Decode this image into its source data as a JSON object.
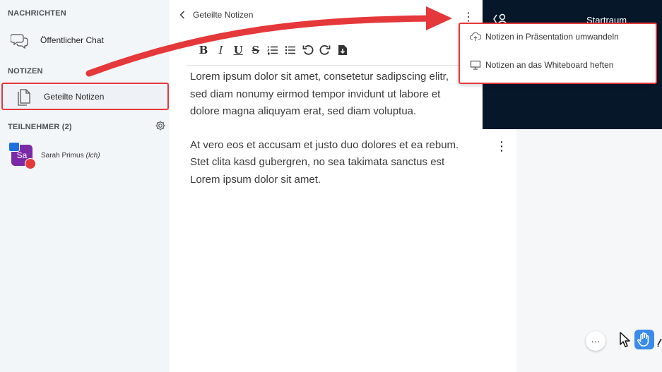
{
  "sidebar": {
    "messages_title": "NACHRICHTEN",
    "public_chat_label": "Öffentlicher Chat",
    "notes_title": "NOTIZEN",
    "shared_notes_label": "Geteilte Notizen",
    "participants_title": "TEILNEHMER (2)",
    "user": {
      "initials": "Sa",
      "name": "Sarah Primus",
      "you_label": "(Ich)"
    }
  },
  "notes": {
    "header_title": "Geteilte Notizen",
    "toolbar": {
      "bold": "B",
      "italic": "I",
      "underline": "U",
      "strike": "S"
    },
    "paragraphs": [
      "Lorem ipsum dolor sit amet, consetetur sadipscing elitr, sed diam nonumy eirmod tempor invidunt ut labore et dolore magna aliquyam erat, sed diam voluptua.",
      "At vero eos et accusam et justo duo dolores et ea rebum. Stet clita kasd gubergren, no sea takimata sanctus est Lorem ipsum dolor sit amet."
    ]
  },
  "menu": {
    "item1": "Notizen in Präsentation umwandeln",
    "item2": "Notizen an das Whiteboard heften"
  },
  "room": {
    "title": "Startraum"
  },
  "colors": {
    "highlight": "#e5383b",
    "video_bg": "#06172a",
    "avatar": "#7a2aa6",
    "raise_hand": "#3b8bea"
  }
}
